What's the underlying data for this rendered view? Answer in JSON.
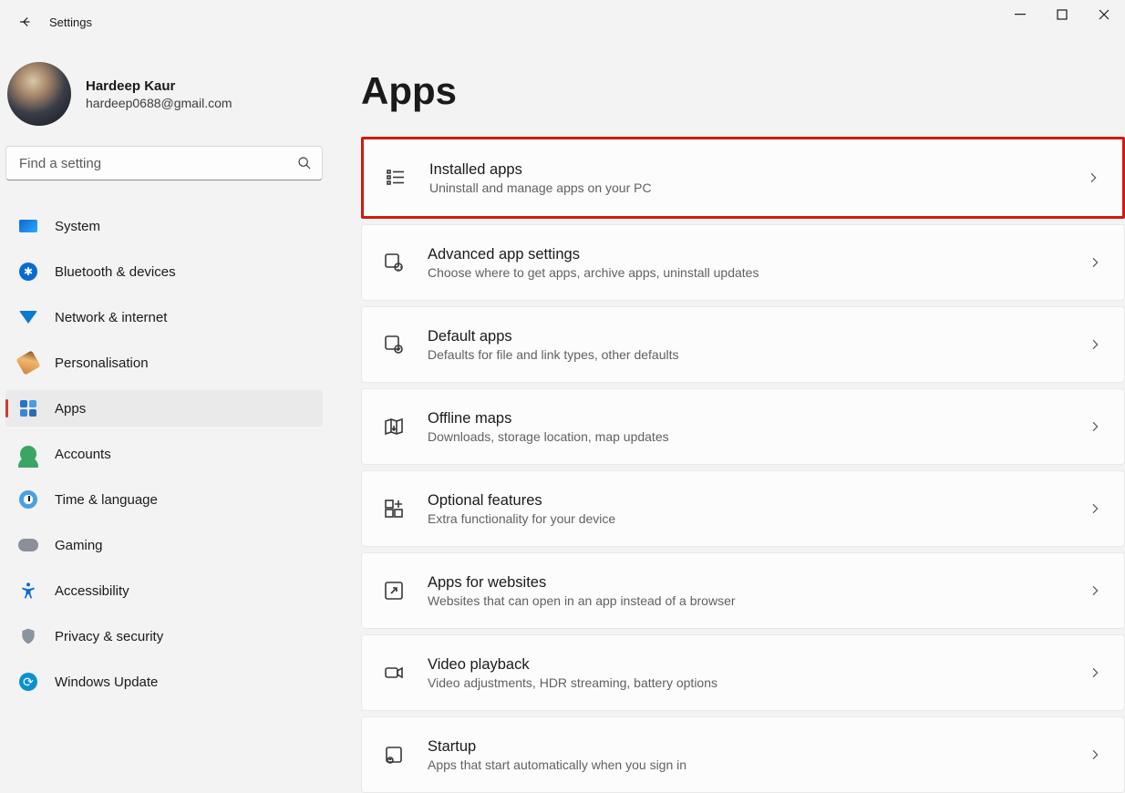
{
  "window": {
    "title": "Settings"
  },
  "profile": {
    "name": "Hardeep Kaur",
    "email": "hardeep0688@gmail.com"
  },
  "search": {
    "placeholder": "Find a setting"
  },
  "nav": {
    "items": [
      {
        "id": "system",
        "label": "System",
        "active": false
      },
      {
        "id": "bluetooth",
        "label": "Bluetooth & devices",
        "active": false
      },
      {
        "id": "network",
        "label": "Network & internet",
        "active": false
      },
      {
        "id": "personal",
        "label": "Personalisation",
        "active": false
      },
      {
        "id": "apps",
        "label": "Apps",
        "active": true
      },
      {
        "id": "accounts",
        "label": "Accounts",
        "active": false
      },
      {
        "id": "time",
        "label": "Time & language",
        "active": false
      },
      {
        "id": "gaming",
        "label": "Gaming",
        "active": false
      },
      {
        "id": "a11y",
        "label": "Accessibility",
        "active": false
      },
      {
        "id": "privacy",
        "label": "Privacy & security",
        "active": false
      },
      {
        "id": "update",
        "label": "Windows Update",
        "active": false
      }
    ]
  },
  "page": {
    "title": "Apps"
  },
  "cards": [
    {
      "id": "installed",
      "title": "Installed apps",
      "desc": "Uninstall and manage apps on your PC",
      "highlight": true
    },
    {
      "id": "advanced",
      "title": "Advanced app settings",
      "desc": "Choose where to get apps, archive apps, uninstall updates",
      "highlight": false
    },
    {
      "id": "default",
      "title": "Default apps",
      "desc": "Defaults for file and link types, other defaults",
      "highlight": false
    },
    {
      "id": "offline",
      "title": "Offline maps",
      "desc": "Downloads, storage location, map updates",
      "highlight": false
    },
    {
      "id": "optional",
      "title": "Optional features",
      "desc": "Extra functionality for your device",
      "highlight": false
    },
    {
      "id": "websites",
      "title": "Apps for websites",
      "desc": "Websites that can open in an app instead of a browser",
      "highlight": false
    },
    {
      "id": "video",
      "title": "Video playback",
      "desc": "Video adjustments, HDR streaming, battery options",
      "highlight": false
    },
    {
      "id": "startup",
      "title": "Startup",
      "desc": "Apps that start automatically when you sign in",
      "highlight": false
    }
  ]
}
